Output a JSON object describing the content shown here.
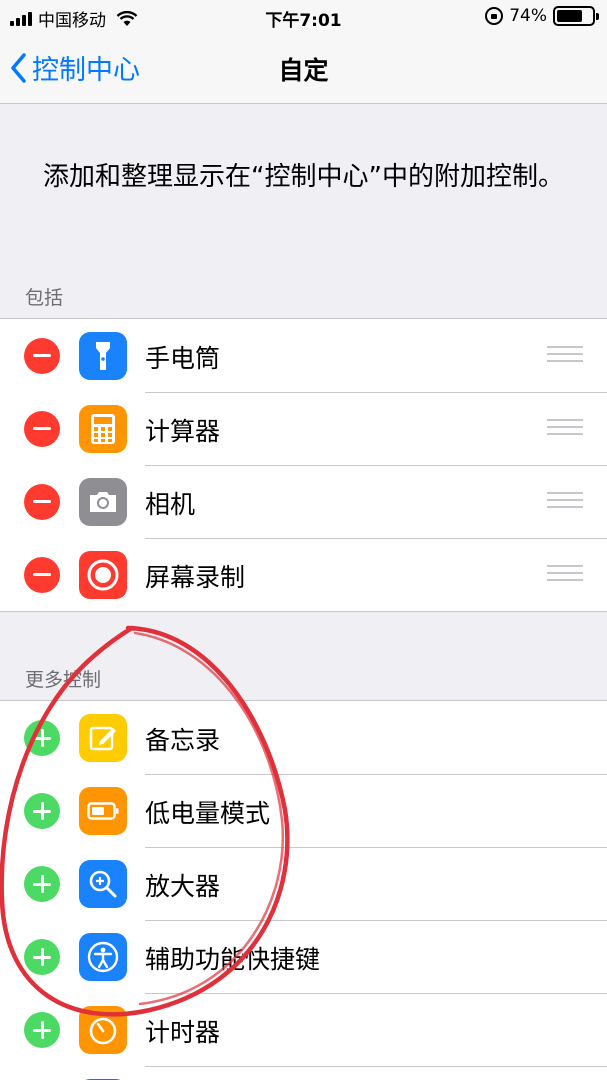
{
  "status_bar": {
    "carrier": "中国移动",
    "time": "下午7:01",
    "battery_percent": "74%",
    "battery_level": 0.74
  },
  "nav": {
    "back_label": "控制中心",
    "title": "自定"
  },
  "intro_text": "添加和整理显示在“控制中心”中的附加控制。",
  "included": {
    "header": "包括",
    "items": [
      {
        "label": "手电筒",
        "icon": "flashlight-icon",
        "color": "#1a82fb"
      },
      {
        "label": "计算器",
        "icon": "calculator-icon",
        "color": "#ff9500"
      },
      {
        "label": "相机",
        "icon": "camera-icon",
        "color": "#8e8e93"
      },
      {
        "label": "屏幕录制",
        "icon": "screen-record-icon",
        "color": "#ff3b30"
      }
    ]
  },
  "more": {
    "header": "更多控制",
    "items": [
      {
        "label": "备忘录",
        "icon": "notes-icon",
        "color": "#ffcc00"
      },
      {
        "label": "低电量模式",
        "icon": "low-power-icon",
        "color": "#ff9500"
      },
      {
        "label": "放大器",
        "icon": "magnifier-icon",
        "color": "#1a82fb"
      },
      {
        "label": "辅助功能快捷键",
        "icon": "accessibility-icon",
        "color": "#1a82fb"
      },
      {
        "label": "计时器",
        "icon": "timer-icon",
        "color": "#ff9500"
      }
    ]
  },
  "colors": {
    "accent": "#007aff",
    "remove": "#ff3b30",
    "add": "#4cd964",
    "annotation": "#e0303a"
  }
}
